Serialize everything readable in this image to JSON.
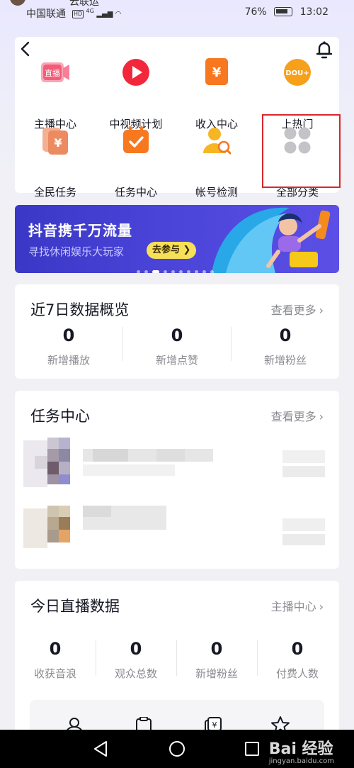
{
  "status_bar": {
    "top_name": "云联运",
    "carrier": "中国联通",
    "hd": "HD",
    "network": "4G",
    "battery": "76%",
    "time": "13:02"
  },
  "grid": {
    "items": [
      {
        "label": "主播中心",
        "icon": "live-streaming-icon"
      },
      {
        "label": "中视频计划",
        "icon": "video-play-icon"
      },
      {
        "label": "收入中心",
        "icon": "yuan-income-icon"
      },
      {
        "label": "上热门",
        "icon": "dou-plus-icon"
      },
      {
        "label": "全民任务",
        "icon": "task-card-icon"
      },
      {
        "label": "任务中心",
        "icon": "calendar-check-icon"
      },
      {
        "label": "帐号检测",
        "icon": "account-search-icon"
      },
      {
        "label": "全部分类",
        "icon": "four-dots-icon"
      }
    ]
  },
  "banner": {
    "title": "抖音携千万流量",
    "subtitle": "寻找休闲娱乐大玩家",
    "button": "去参与 ❯",
    "dot_count": 10,
    "active_dot": 2
  },
  "data_overview": {
    "title": "近7日数据概览",
    "more": "查看更多",
    "stats": [
      {
        "value": "0",
        "label": "新增播放"
      },
      {
        "value": "0",
        "label": "新增点赞"
      },
      {
        "value": "0",
        "label": "新增粉丝"
      }
    ]
  },
  "task_center": {
    "title": "任务中心",
    "more": "查看更多"
  },
  "live_data": {
    "title": "今日直播数据",
    "more": "主播中心",
    "stats": [
      {
        "value": "0",
        "label": "收获音浪"
      },
      {
        "value": "0",
        "label": "观众总数"
      },
      {
        "value": "0",
        "label": "新增粉丝"
      },
      {
        "value": "0",
        "label": "付费人数"
      }
    ]
  },
  "watermark": {
    "text": "Bai 经验",
    "url": "jingyan.baidu.com"
  },
  "colors": {
    "accent_red": "#d9272c",
    "banner_bg": "#4a44d8",
    "banner_button": "#f6e05a",
    "text_primary": "#161823",
    "text_secondary": "#8a8b91"
  }
}
